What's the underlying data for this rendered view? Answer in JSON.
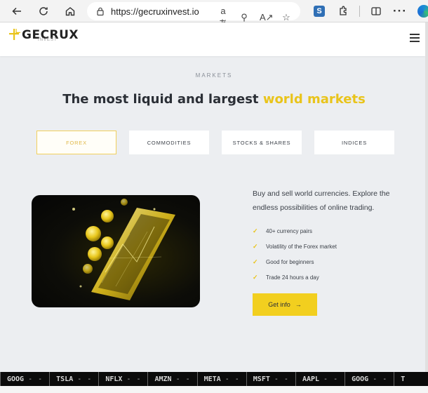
{
  "browser": {
    "url": "https://gecruxinvest.io",
    "read_aloud": "aあ",
    "icons": [
      "back-arrow-icon",
      "refresh-icon",
      "home-icon",
      "lock-icon",
      "zoom-icon",
      "read-aloud-icon",
      "favorite-star-icon",
      "extension-s-icon",
      "extensions-puzzle-icon",
      "split-screen-icon",
      "more-icon",
      "edge-profile-icon"
    ]
  },
  "site": {
    "logo_text": "GECRUX",
    "logo_sub": "INVEST"
  },
  "section": {
    "eyebrow": "MARKETS",
    "headline_main": "The most liquid and largest ",
    "headline_accent": "world markets",
    "accent_color": "#e9c41b"
  },
  "tabs": [
    {
      "label": "FOREX",
      "active": true
    },
    {
      "label": "COMMODITIES",
      "active": false
    },
    {
      "label": "STOCKS & SHARES",
      "active": false
    },
    {
      "label": "INDICES",
      "active": false
    }
  ],
  "forex": {
    "description": "Buy and sell world currencies. Explore the endless possibilities of online trading.",
    "features": [
      "40+ currency pairs",
      "Volatility of the Forex market",
      "Good for beginners",
      "Trade 24 hours a day"
    ],
    "cta_label": "Get info",
    "cta_color": "#f2cf1f"
  },
  "ticker": [
    {
      "symbol": "GOOG",
      "value": "- -"
    },
    {
      "symbol": "TSLA",
      "value": "- -"
    },
    {
      "symbol": "NFLX",
      "value": "- -"
    },
    {
      "symbol": "AMZN",
      "value": "- -"
    },
    {
      "symbol": "META",
      "value": "- -"
    },
    {
      "symbol": "MSFT",
      "value": "- -"
    },
    {
      "symbol": "AAPL",
      "value": "- -"
    },
    {
      "symbol": "GOOG",
      "value": "- -"
    },
    {
      "symbol": "T",
      "value": ""
    }
  ]
}
